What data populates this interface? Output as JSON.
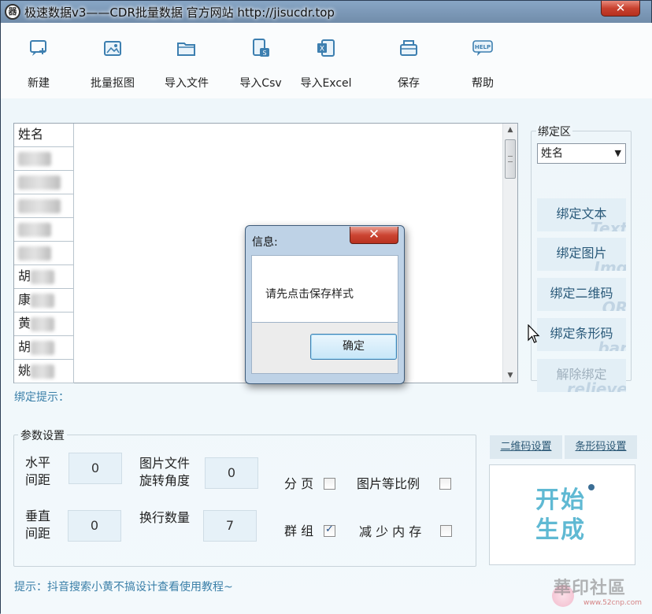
{
  "window": {
    "title": "极速数据v3——CDR批量数据  官方网站 http://jisucdr.top",
    "close_glyph": "✕",
    "app_icon_glyph": "器"
  },
  "toolbar": {
    "items": [
      {
        "label": "新建",
        "icon": "new-file-icon"
      },
      {
        "label": "批量抠图",
        "icon": "image-cutout-icon"
      },
      {
        "label": "导入文件",
        "icon": "folder-open-icon"
      },
      {
        "label": "导入Csv",
        "icon": "csv-file-icon"
      },
      {
        "label": "导入Excel",
        "icon": "excel-file-icon"
      },
      {
        "label": "保存",
        "icon": "save-tray-icon"
      },
      {
        "label": "帮助",
        "icon": "help-bubble-icon"
      }
    ]
  },
  "grid": {
    "header": "姓名",
    "rows": [
      "",
      "",
      "",
      "",
      "",
      "胡",
      "康",
      "黄",
      "胡",
      "姚"
    ]
  },
  "bind_tip": "绑定提示：",
  "bind_panel": {
    "legend": "绑定区",
    "selected_field": "姓名",
    "buttons": [
      {
        "label": "绑定文本",
        "wm": "Text",
        "disabled": false
      },
      {
        "label": "绑定图片",
        "wm": "Img",
        "disabled": false
      },
      {
        "label": "绑定二维码",
        "wm": "QR",
        "disabled": false
      },
      {
        "label": "绑定条形码",
        "wm": "bar",
        "disabled": false
      },
      {
        "label": "解除绑定",
        "wm": "relieve",
        "disabled": true
      }
    ]
  },
  "params": {
    "legend": "参数设置",
    "h_spacing_label_1": "水平",
    "h_spacing_label_2": "间距",
    "h_spacing_value": "0",
    "v_spacing_label_1": "垂直",
    "v_spacing_label_2": "间距",
    "v_spacing_value": "0",
    "rotate_label_1": "图片文件",
    "rotate_label_2": "旋转角度",
    "rotate_value": "0",
    "wrap_label": "换行数量",
    "wrap_value": "7",
    "paging_label": "分 页",
    "paging_checked": false,
    "group_label": "群 组",
    "group_checked": true,
    "ratio_label": "图片等比例",
    "ratio_checked": false,
    "low_mem_label": "减 少 内 存",
    "low_mem_checked": false
  },
  "settings_tabs": {
    "qr": "二维码设置",
    "barcode": "条形码设置"
  },
  "start_button": {
    "line1": "开始",
    "line2": "生成"
  },
  "hint": "提示：抖音搜索小黄不搞设计查看使用教程~",
  "dialog": {
    "title": "信息:",
    "close_glyph": "✕",
    "message": "请先点击保存样式",
    "ok_label": "确定"
  },
  "watermark": {
    "text": "華印社區",
    "sub": "www.52cnp.com"
  }
}
